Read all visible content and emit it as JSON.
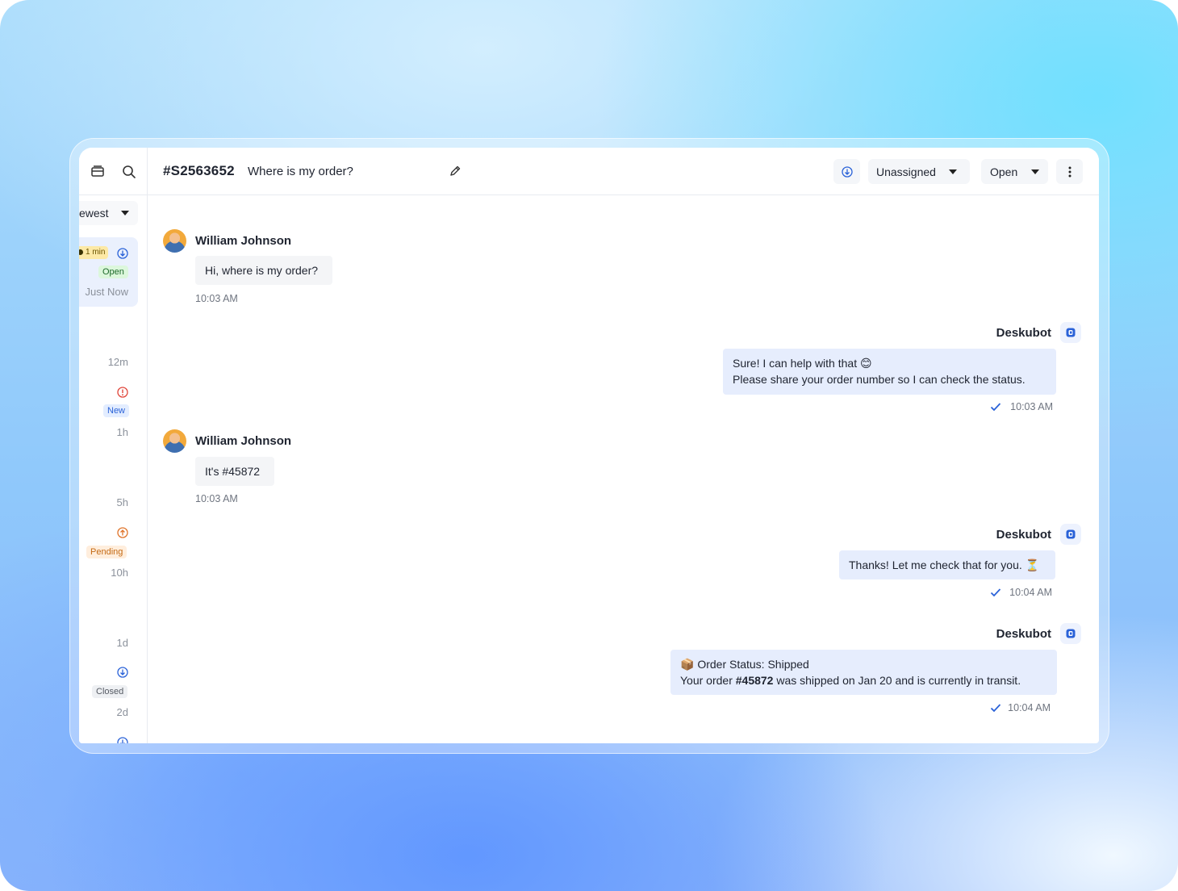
{
  "sidebar": {
    "sort_label": "ewest",
    "conversations": [
      {
        "sla": "1 min",
        "status": "Open",
        "time": "Just Now"
      },
      {
        "time": "12m"
      },
      {
        "status": "New",
        "time": "1h"
      },
      {
        "time": "5h"
      },
      {
        "status": "Pending",
        "time": "10h"
      },
      {
        "time": "1d"
      },
      {
        "status": "Closed",
        "time": "2d"
      }
    ]
  },
  "header": {
    "ticket_id": "#S2563652",
    "title": "Where is my order?",
    "assignee": "Unassigned",
    "status": "Open"
  },
  "messages": [
    {
      "sender": "William Johnson",
      "text": "Hi, where is my order?",
      "time": "10:03 AM"
    },
    {
      "sender": "Deskubot",
      "line1": "Sure! I can help with that 😊",
      "line2": "Please share your order number so I can check the status.",
      "time": "10:03 AM"
    },
    {
      "sender": "William Johnson",
      "text": "It's #45872",
      "time": "10:03 AM"
    },
    {
      "sender": "Deskubot",
      "text": "Thanks! Let me check that for you. ⏳",
      "time": "10:04 AM"
    },
    {
      "sender": "Deskubot",
      "line1": "📦 Order Status: Shipped",
      "line2_prefix": "Your order ",
      "line2_bold": "#45872",
      "line2_suffix": " was shipped on Jan 20 and is currently in transit.",
      "time": "10:04 AM"
    }
  ],
  "colors": {
    "accent": "#2a62d8",
    "bot_bubble": "#e6edfd",
    "user_bubble": "#f4f5f7"
  }
}
